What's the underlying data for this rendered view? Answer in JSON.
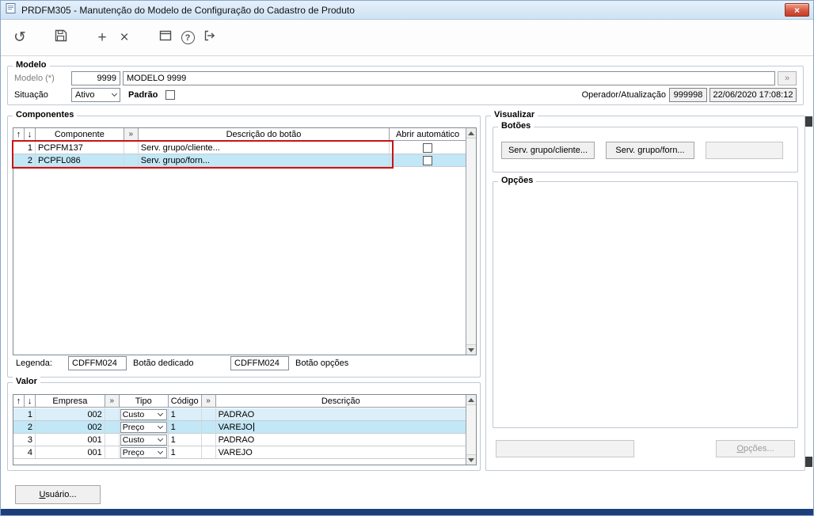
{
  "window": {
    "title": "PRDFM305 - Manutenção do Modelo de Configuração do Cadastro de Produto",
    "close_glyph": "×"
  },
  "toolbar": {
    "buttons": [
      "undo",
      "save",
      "add",
      "delete",
      "form",
      "help",
      "exit"
    ]
  },
  "icons": {
    "up_arrow": "↑",
    "down_arrow": "↓",
    "double_chevron": "»",
    "undo": "↺",
    "plus": "+",
    "delete": "×",
    "help": "?"
  },
  "modelo": {
    "legend": "Modelo",
    "modelo_label": "Modelo (*)",
    "modelo_code": "9999",
    "modelo_name": "MODELO 9999",
    "situacao_label": "Situação",
    "situacao_value": "Ativo",
    "padrao_label": "Padrão",
    "padrao_checked": false,
    "operador_label": "Operador/Atualização",
    "operador_value": "999998",
    "atualizacao_value": "22/06/2020 17:08:12"
  },
  "componentes": {
    "legend": "Componentes",
    "headers": {
      "componente": "Componente",
      "descricao": "Descrição do botão",
      "abrir": "Abrir automático"
    },
    "rows": [
      {
        "num": "1",
        "componente": "PCPFM137",
        "descricao": "Serv. grupo/cliente...",
        "abrir_checked": false,
        "selected": false
      },
      {
        "num": "2",
        "componente": "PCPFL086",
        "descricao": "Serv. grupo/forn...",
        "abrir_checked": false,
        "selected": true
      }
    ],
    "legenda": {
      "label": "Legenda:",
      "dedicado_value": "CDFFM024",
      "dedicado_label": "Botão dedicado",
      "opcoes_value": "CDFFM024",
      "opcoes_label": "Botão opções"
    }
  },
  "visualizar": {
    "legend": "Visualizar",
    "botoes": {
      "legend": "Botões",
      "buttons": [
        "Serv. grupo/cliente...",
        "Serv. grupo/forn...",
        ""
      ]
    },
    "opcoes": {
      "legend": "Opções"
    },
    "bottom": {
      "blank_button": "",
      "opcoes_button": "Opções..."
    }
  },
  "valor": {
    "legend": "Valor",
    "headers": {
      "empresa": "Empresa",
      "tipo": "Tipo",
      "codigo": "Código",
      "descricao": "Descrição"
    },
    "rows": [
      {
        "num": "1",
        "empresa": "002",
        "tipo": "Custo",
        "codigo": "1",
        "descricao": "PADRAO",
        "highlight": "light",
        "editing": false
      },
      {
        "num": "2",
        "empresa": "002",
        "tipo": "Preço",
        "codigo": "1",
        "descricao": "VAREJO",
        "highlight": "selected",
        "editing": true
      },
      {
        "num": "3",
        "empresa": "001",
        "tipo": "Custo",
        "codigo": "1",
        "descricao": "PADRAO",
        "highlight": "none",
        "editing": false
      },
      {
        "num": "4",
        "empresa": "001",
        "tipo": "Preço",
        "codigo": "1",
        "descricao": "VAREJO",
        "highlight": "none",
        "editing": false
      }
    ]
  },
  "footer": {
    "usuario_button": "Usuário..."
  },
  "colors": {
    "selected_row": "#c2e7f6",
    "light_row": "#dbeffa",
    "annotation_red": "#c81414",
    "titlebar": "#d9e7f6",
    "bottom_strip": "#1b3f7a"
  }
}
